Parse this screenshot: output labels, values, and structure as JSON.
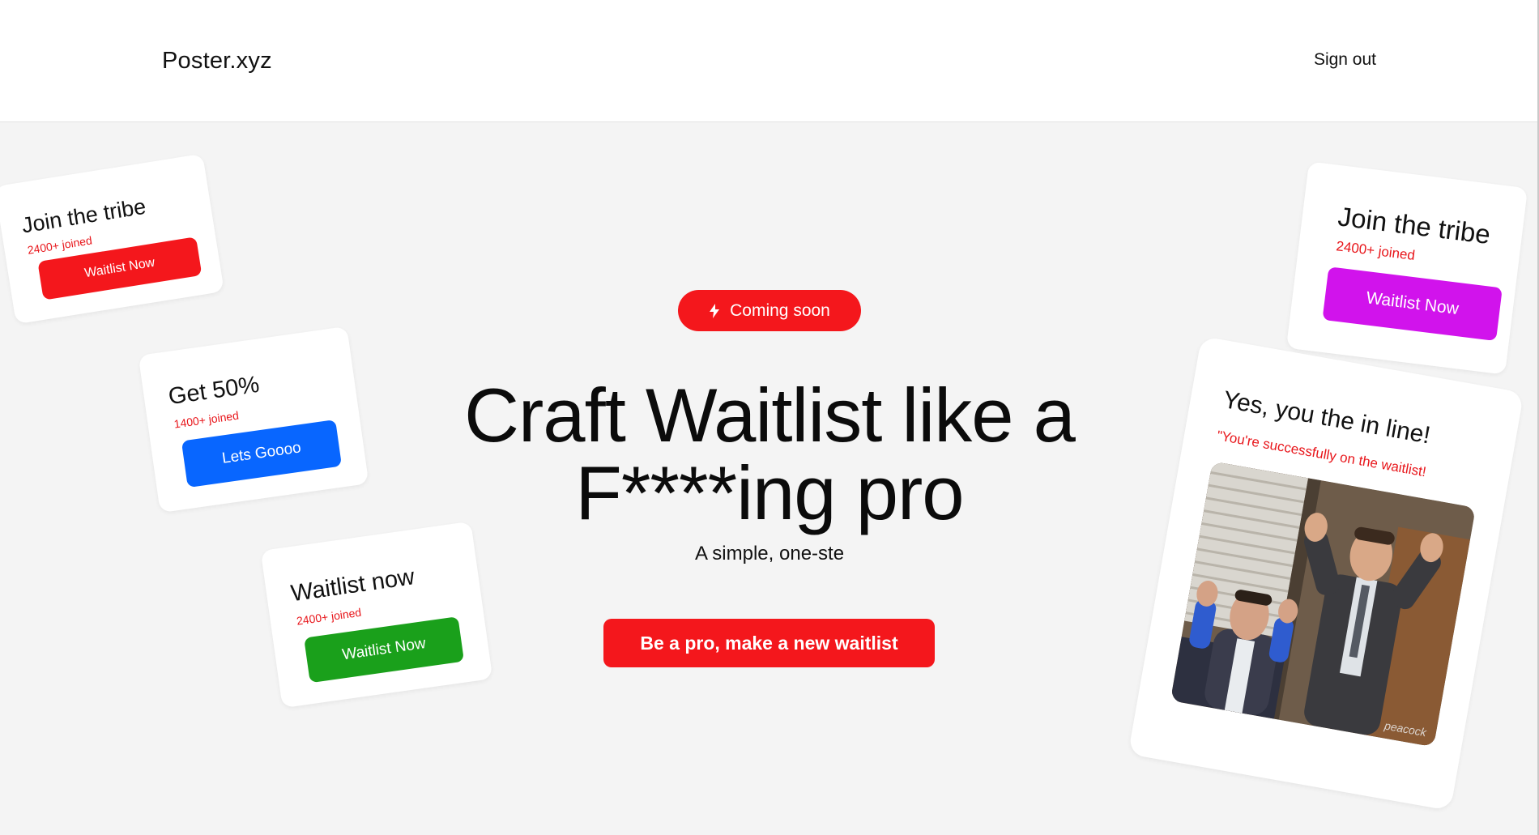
{
  "header": {
    "logo": "Poster.xyz",
    "sign_out": "Sign out"
  },
  "hero": {
    "badge": "Coming soon",
    "badge_icon": "bolt-icon",
    "headline_line1": "Craft Waitlist like a",
    "headline_line2": "F****ing pro",
    "subhead": "A simple, one-ste",
    "cta": "Be a pro, make a new waitlist"
  },
  "cards": [
    {
      "title": "Join the tribe",
      "count": "2400+ joined",
      "button": "Waitlist Now",
      "color": "#f4171c"
    },
    {
      "title": "Get 50%",
      "count": "1400+ joined",
      "button": "Lets Goooo",
      "color": "#0866ff"
    },
    {
      "title": "Waitlist now",
      "count": "2400+ joined",
      "button": "Waitlist Now",
      "color": "#1aa01b"
    },
    {
      "title": "Join the tribe",
      "count": "2400+ joined",
      "button": "Waitlist Now",
      "color": "#d113ec"
    }
  ],
  "success": {
    "title": "Yes, you the in line!",
    "subtitle": "\"You're successfully on the waitlist!",
    "watermark": "peacock"
  },
  "colors": {
    "accent_red": "#f4171c",
    "background": "#f4f4f4"
  }
}
